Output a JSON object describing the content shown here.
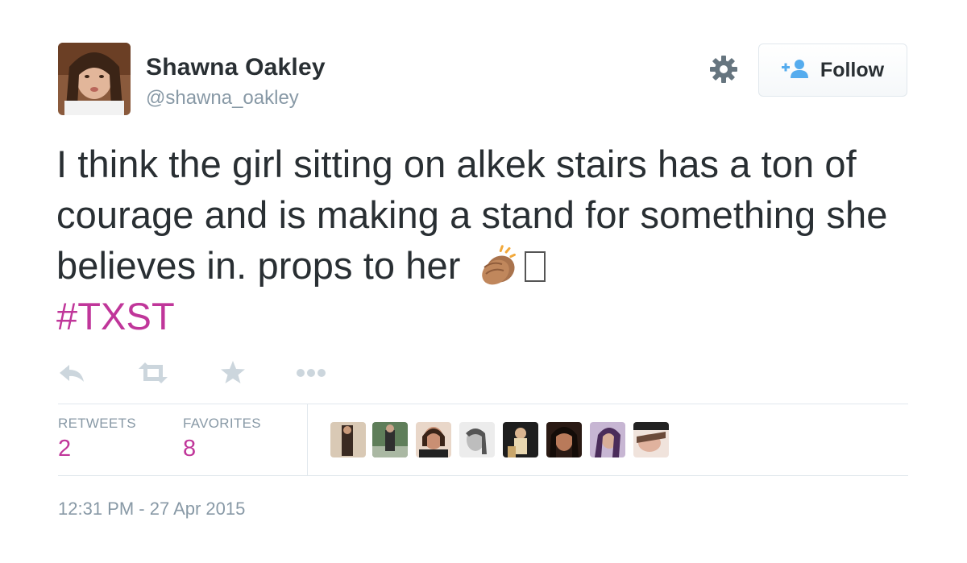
{
  "author": {
    "full_name": "Shawna Oakley",
    "username": "@shawna_oakley"
  },
  "header": {
    "follow_label": "Follow",
    "settings_icon": "gear-icon",
    "follow_icon": "add-user-icon"
  },
  "tweet": {
    "text": "I think the girl sitting on alkek stairs has a ton of courage and is making a stand for something she believes in. props to her",
    "emoji": "clapping-hands-icon",
    "hashtag": "#TXST"
  },
  "actions": [
    "reply-icon",
    "retweet-icon",
    "favorite-icon",
    "more-icon"
  ],
  "stats": {
    "retweets_label": "RETWEETS",
    "retweets_count": "2",
    "favorites_label": "FAVORITES",
    "favorites_count": "8"
  },
  "favorited_by_count": 8,
  "timestamp": "12:31 PM - 27 Apr 2015",
  "colors": {
    "text": "#292f33",
    "muted": "#8899a6",
    "hashtag": "#c0369a",
    "follow_icon": "#55acee",
    "border": "#e1e8ed"
  }
}
